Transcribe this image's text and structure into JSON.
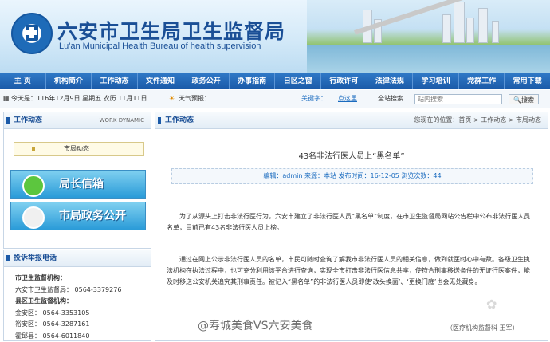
{
  "header": {
    "title": "六安市卫生局卫生监督局",
    "subtitle": "Lu'an Municipal Health Bureau of health supervision"
  },
  "nav": {
    "items": [
      "主  页",
      "机构简介",
      "工作动态",
      "文件通知",
      "政务公开",
      "办事指南",
      "日区之窗",
      "行政许可",
      "法律法规",
      "学习培训",
      "党群工作",
      "常用下载"
    ]
  },
  "infobar": {
    "date": "今天是：116年12月9日 星期五 农历 11月11日",
    "weather": "天气预报：",
    "hot_label": "关键字：",
    "hot_value": "点这里",
    "search_label": "全站搜索",
    "search_placeholder": "站内搜索",
    "search_button": "搜索"
  },
  "left": {
    "panel_title": "工作动态",
    "panel_en": "WORK DYNAMIC",
    "subtab": "市局动态",
    "promo1": "局长信箱",
    "promo2": "市局政务公开",
    "panel2_title": "投诉举报电话",
    "lines": [
      {
        "text": "市卫生监督机构：",
        "bold": true
      },
      {
        "text": "六安市卫生监督局： 0564-3379276",
        "bold": false
      },
      {
        "text": "县区卫生监督机构：",
        "bold": true
      },
      {
        "text": "金安区： 0564-3353105",
        "bold": false
      },
      {
        "text": "裕安区： 0564-3287161",
        "bold": false
      },
      {
        "text": "霍邱县： 0564-6011840",
        "bold": false
      }
    ]
  },
  "main": {
    "panel_title": "工作动态",
    "breadcrumb": "您现在的位置：首页 > 工作动态 > 市局动态",
    "article_title": "43名非法行医人员上“黑名单”",
    "meta": "编辑：admin 来源：本站 发布时间：16-12-05 浏览次数：44",
    "para1": "为了从源头上打击非法行医行为，六安市建立了非法行医人员“黑名单”制度，在市卫生监督局网站公告栏中公布非法行医人员名单，目前已有43名非法行医人员上榜。",
    "para2": "通过在网上公示非法行医人员的名单，市民可随时查询了解我市非法行医人员的相关信息，做到就医时心中有数。各级卫生执法机构在执法过程中，也可充分利用该平台进行查询，实现全市打击非法行医信息共享，使符合刑事移送条件的无证行医案件，能及时移送公安机关追究其刑事责任。被记入“黑名单”的非法行医人员即使‘改头换面’、‘更换门庭’也会无处藏身。",
    "source": "（医疗机构监督科  王军）"
  },
  "overlay": {
    "watermark": "@寿城美食VS六安美食"
  },
  "colors": {
    "brand_blue": "#1a4f96",
    "nav_blue": "#1b5aa8",
    "link_blue": "#1a6bbf"
  }
}
